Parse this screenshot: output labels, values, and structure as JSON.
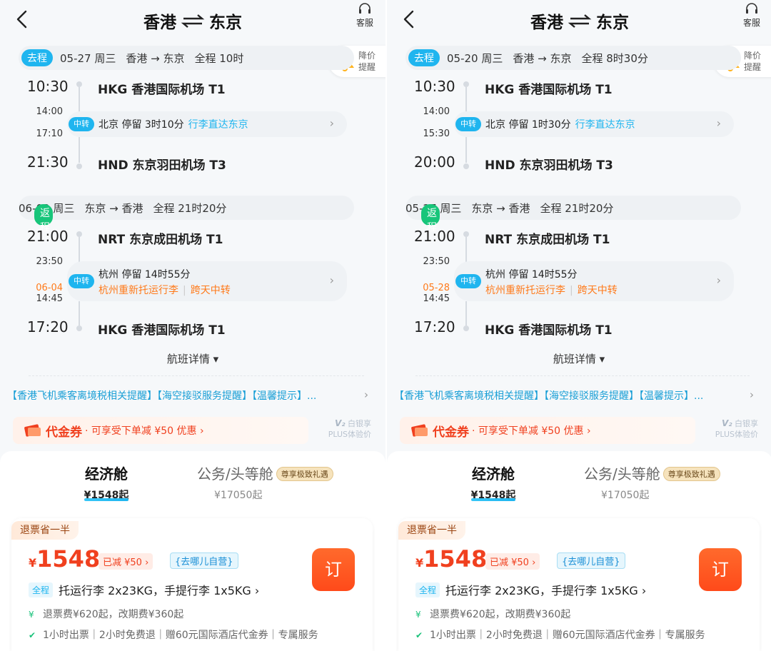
{
  "panels": [
    {
      "header": {
        "from": "香港",
        "to": "东京",
        "service_label": "客服"
      },
      "reminder": {
        "label1": "降价",
        "label2": "提醒"
      },
      "outbound": {
        "tag": "去程",
        "date": "05-27 周三",
        "route": "香港 → 东京",
        "duration": "全程 10时",
        "dep_time": "10:30",
        "dep_airport": "HKG 香港国际机场 T1",
        "transfer": {
          "badge": "中转",
          "arr_time": "14:00",
          "dep_time": "17:10",
          "city": "北京",
          "stay": "停留 3时10分",
          "note": "行李直达东京"
        },
        "arr_time": "21:30",
        "arr_airport": "HND 东京羽田机场 T3"
      },
      "inbound": {
        "tag": "返程",
        "date": "06-03 周三",
        "route": "东京 → 香港",
        "duration": "全程 21时20分",
        "dep_time": "21:00",
        "dep_airport": "NRT 东京成田机场 T1",
        "transfer": {
          "badge": "中转",
          "arr_time": "23:50",
          "next_date": "06-04",
          "dep_time": "14:45",
          "city": "杭州",
          "stay": "停留 14时55分",
          "warn1": "杭州重新托运行李",
          "warn2": "跨天中转"
        },
        "arr_time": "17:20",
        "arr_airport": "HKG 香港国际机场 T1"
      },
      "detail_label": "航班详情 ▾",
      "notice": "【香港飞机乘客离境税相关提醒】【海空接驳服务提醒】【温馨提示】...",
      "coupon": {
        "title": "代金券",
        "desc": "· 可享受下单减 ¥50 优惠 ›"
      },
      "plus": {
        "line1": "白银享",
        "line2": "PLUS体验价"
      },
      "cabins": {
        "economy": "经济舱",
        "economy_price": "¥1548起",
        "business": "公务/头等舱",
        "vip_tag": "尊享极致礼遇",
        "business_price": "¥17050起"
      },
      "offer": {
        "badge": "退票省一半",
        "yen": "¥",
        "price": "1548",
        "discount": "已减 ¥50 ›",
        "self": "{去哪儿自营}",
        "book": "订",
        "whole": "全程",
        "luggage": "托运行李 2x23KG，手提行李 1x5KG ›",
        "fee": "退票费¥620起，改期费¥360起",
        "services": "1小时出票｜2小时免费退｜赠60元国际酒店代金券｜专属服务"
      }
    },
    {
      "header": {
        "from": "香港",
        "to": "东京",
        "service_label": "客服"
      },
      "reminder": {
        "label1": "降价",
        "label2": "提醒"
      },
      "outbound": {
        "tag": "去程",
        "date": "05-20 周三",
        "route": "香港 → 东京",
        "duration": "全程 8时30分",
        "dep_time": "10:30",
        "dep_airport": "HKG 香港国际机场 T1",
        "transfer": {
          "badge": "中转",
          "arr_time": "14:00",
          "dep_time": "15:30",
          "city": "北京",
          "stay": "停留 1时30分",
          "note": "行李直达东京"
        },
        "arr_time": "20:00",
        "arr_airport": "HND 东京羽田机场 T3"
      },
      "inbound": {
        "tag": "返程",
        "date": "05-27 周三",
        "route": "东京 → 香港",
        "duration": "全程 21时20分",
        "dep_time": "21:00",
        "dep_airport": "NRT 东京成田机场 T1",
        "transfer": {
          "badge": "中转",
          "arr_time": "23:50",
          "next_date": "05-28",
          "dep_time": "14:45",
          "city": "杭州",
          "stay": "停留 14时55分",
          "warn1": "杭州重新托运行李",
          "warn2": "跨天中转"
        },
        "arr_time": "17:20",
        "arr_airport": "HKG 香港国际机场 T1"
      },
      "detail_label": "航班详情 ▾",
      "notice": "【香港飞机乘客离境税相关提醒】【海空接驳服务提醒】【温馨提示】...",
      "coupon": {
        "title": "代金券",
        "desc": "· 可享受下单减 ¥50 优惠 ›"
      },
      "plus": {
        "line1": "白银享",
        "line2": "PLUS体验价"
      },
      "cabins": {
        "economy": "经济舱",
        "economy_price": "¥1548起",
        "business": "公务/头等舱",
        "vip_tag": "尊享极致礼遇",
        "business_price": "¥17050起"
      },
      "offer": {
        "badge": "退票省一半",
        "yen": "¥",
        "price": "1548",
        "discount": "已减 ¥50 ›",
        "self": "{去哪儿自营}",
        "book": "订",
        "whole": "全程",
        "luggage": "托运行李 2x23KG，手提行李 1x5KG ›",
        "fee": "退票费¥620起，改期费¥360起",
        "services": "1小时出票｜2小时免费退｜赠60元国际酒店代金券｜专属服务"
      }
    }
  ]
}
